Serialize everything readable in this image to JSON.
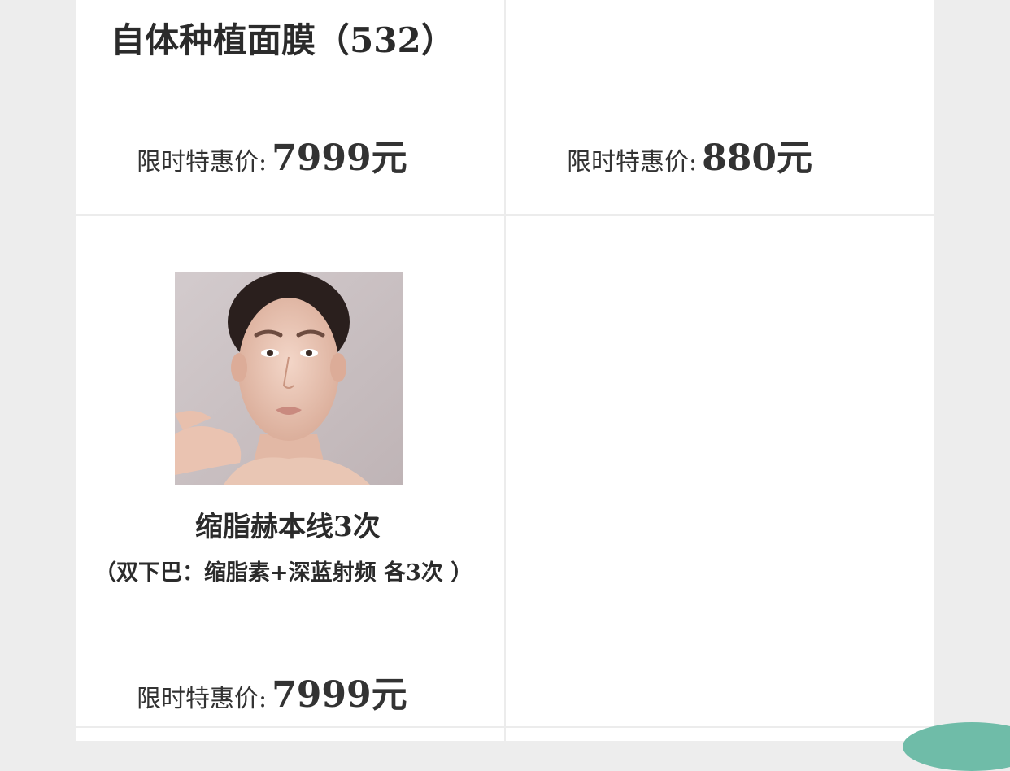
{
  "cards": [
    {
      "title": "自体种植面膜（532）",
      "price_label": "限时特惠价:",
      "price_value": "7999元"
    },
    {
      "price_label": "限时特惠价:",
      "price_value": "880元"
    },
    {
      "title": "缩脂赫本线3次",
      "subtitle": "（双下巴：缩脂素+深蓝射频 各3次 ）",
      "price_label": "限时特惠价:",
      "price_value": "7999元",
      "image_alt": "woman-face-portrait"
    }
  ],
  "colors": {
    "page_bg": "#ededed",
    "card_bg": "#ffffff",
    "divider": "#ececec",
    "text": "#2a2a2a",
    "accent_blob": "#6fbca8"
  }
}
